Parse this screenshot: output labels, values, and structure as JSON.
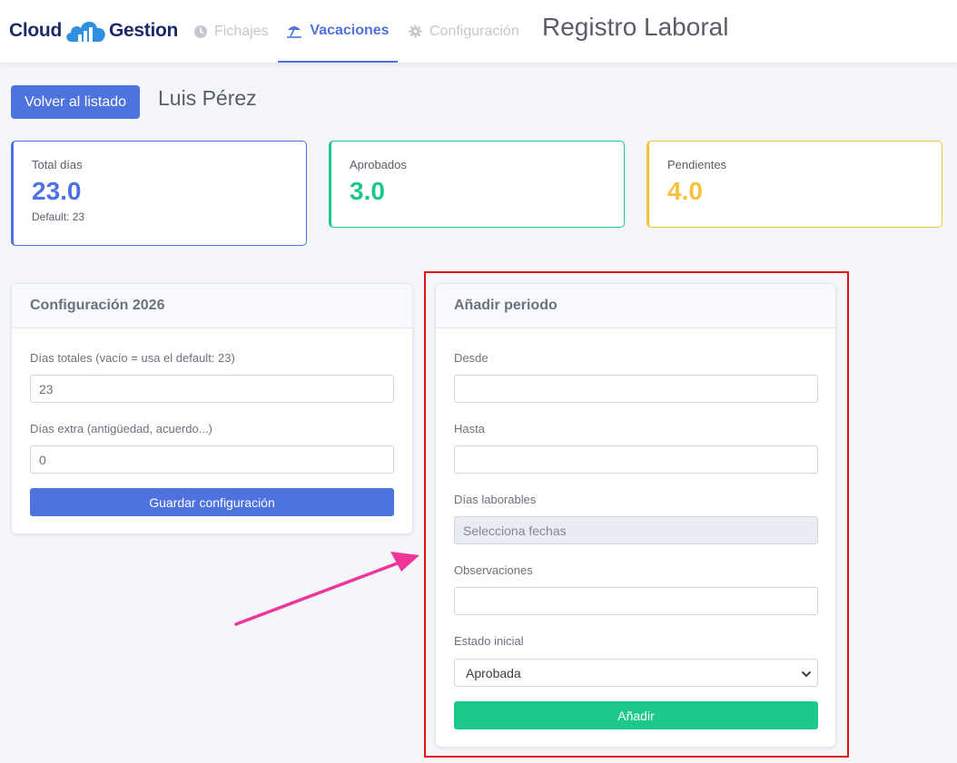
{
  "header": {
    "logo_left": "Cloud",
    "logo_right": "Gestion",
    "nav": [
      {
        "label": "Fichajes",
        "icon": "clock-icon"
      },
      {
        "label": "Vacaciones",
        "icon": "beach-umbrella-icon"
      },
      {
        "label": "Configuración",
        "icon": "gear-icon"
      }
    ],
    "title": "Registro Laboral"
  },
  "page": {
    "back_button": "Volver al listado",
    "employee_name": "Luis Pérez"
  },
  "stats": [
    {
      "label": "Total días",
      "value": "23.0",
      "sub": "Default: 23",
      "color": "#4e73df"
    },
    {
      "label": "Aprobados",
      "value": "3.0",
      "sub": "",
      "color": "#1cc88a"
    },
    {
      "label": "Pendientes",
      "value": "4.0",
      "sub": "",
      "color": "#f6c23e"
    }
  ],
  "config_card": {
    "title": "Configuración 2026",
    "total_label": "Días totales (vacío = usa el default: 23)",
    "total_value": "23",
    "extra_label": "Días extra (antigüedad, acuerdo...)",
    "extra_value": "0",
    "save_button": "Guardar configuración"
  },
  "add_card": {
    "title": "Añadir periodo",
    "from_label": "Desde",
    "from_value": "",
    "to_label": "Hasta",
    "to_value": "",
    "workdays_label": "Días laborables",
    "workdays_value": "Selecciona fechas",
    "notes_label": "Observaciones",
    "notes_value": "",
    "status_label": "Estado inicial",
    "status_value": "Aprobada",
    "add_button": "Añadir"
  },
  "colors": {
    "primary": "#4e73df",
    "success": "#1cc88a",
    "warning": "#f6c23e",
    "highlight": "#e0101d",
    "arrow": "#f0359a"
  }
}
